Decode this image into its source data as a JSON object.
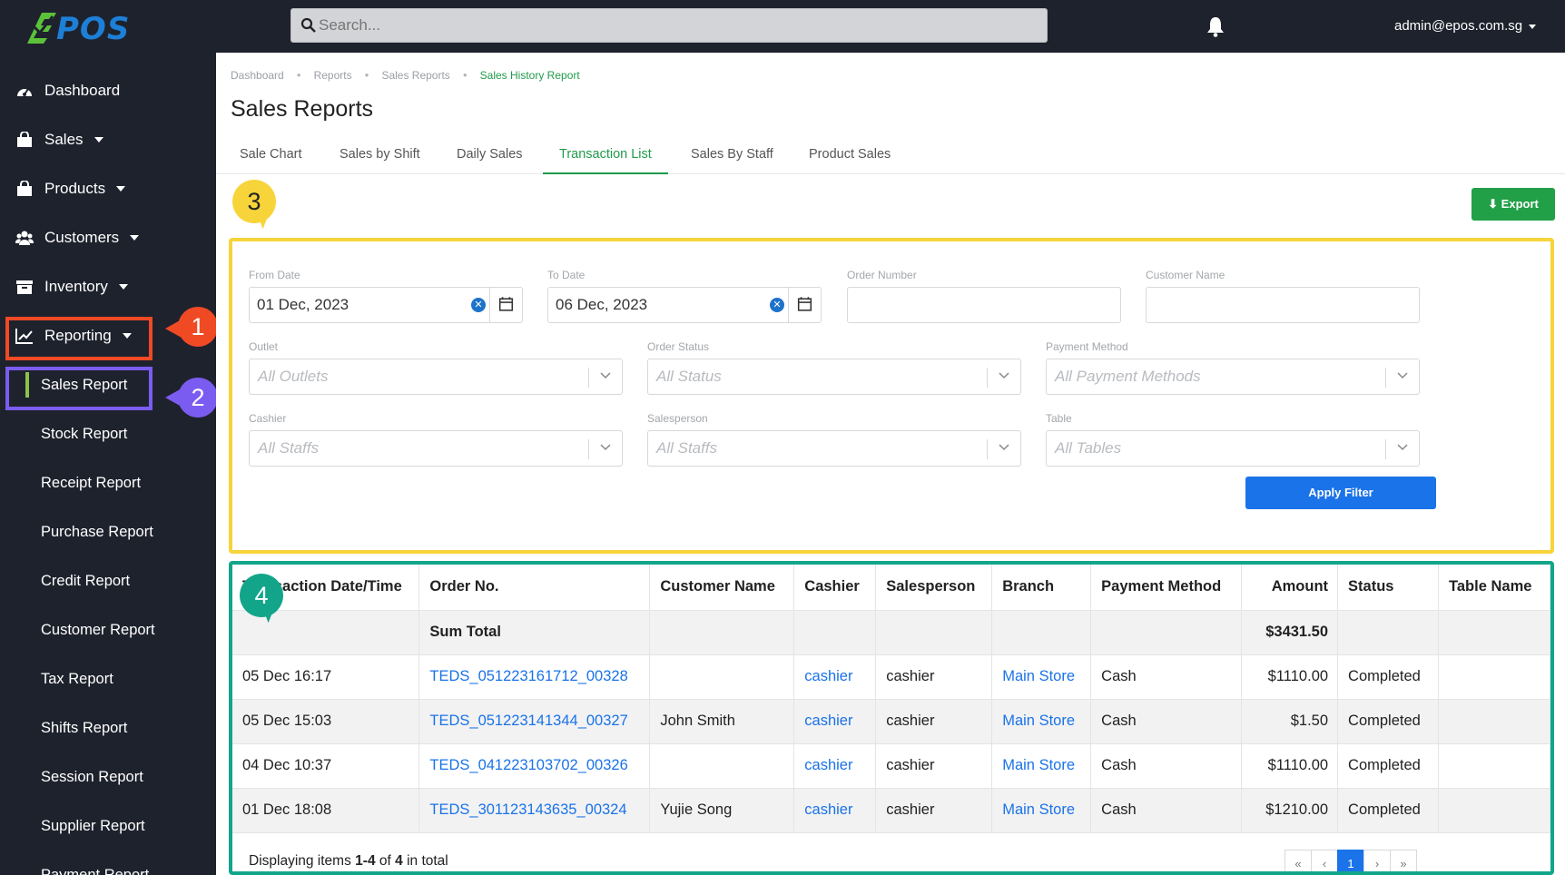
{
  "app": {
    "logo_text": "POS",
    "logo_full": "ePOS",
    "search_placeholder": "Search...",
    "user_email": "admin@epos.com.sg"
  },
  "sidebar": {
    "items": [
      {
        "label": "Dashboard",
        "icon": "dashboard-icon"
      },
      {
        "label": "Sales",
        "icon": "shopping-bag-icon"
      },
      {
        "label": "Products",
        "icon": "box-icon"
      },
      {
        "label": "Customers",
        "icon": "users-icon"
      },
      {
        "label": "Inventory",
        "icon": "archive-icon"
      },
      {
        "label": "Reporting",
        "icon": "line-chart-icon"
      }
    ],
    "subitems": [
      {
        "label": "Sales Report"
      },
      {
        "label": "Stock Report"
      },
      {
        "label": "Receipt Report"
      },
      {
        "label": "Purchase Report"
      },
      {
        "label": "Credit Report"
      },
      {
        "label": "Customer Report"
      },
      {
        "label": "Tax Report"
      },
      {
        "label": "Shifts Report"
      },
      {
        "label": "Session Report"
      },
      {
        "label": "Supplier Report"
      },
      {
        "label": "Payment Report"
      }
    ]
  },
  "annotations": {
    "b1": "1",
    "b2": "2",
    "b3": "3",
    "b4": "4"
  },
  "breadcrumb": [
    "Dashboard",
    "Reports",
    "Sales Reports",
    "Sales History Report"
  ],
  "page_title": "Sales Reports",
  "tabs": [
    "Sale Chart",
    "Sales by Shift",
    "Daily Sales",
    "Transaction List",
    "Sales By Staff",
    "Product Sales"
  ],
  "active_tab": "Transaction List",
  "export_label": "Export",
  "filters": {
    "from_date_label": "From Date",
    "from_date_value": "01 Dec, 2023",
    "to_date_label": "To Date",
    "to_date_value": "06 Dec, 2023",
    "order_number_label": "Order Number",
    "order_number_value": "",
    "customer_name_label": "Customer Name",
    "customer_name_value": "",
    "outlet_label": "Outlet",
    "outlet_placeholder": "All Outlets",
    "order_status_label": "Order Status",
    "order_status_placeholder": "All Status",
    "payment_method_label": "Payment Method",
    "payment_method_placeholder": "All Payment Methods",
    "cashier_label": "Cashier",
    "cashier_placeholder": "All Staffs",
    "salesperson_label": "Salesperson",
    "salesperson_placeholder": "All Staffs",
    "table_label": "Table",
    "table_placeholder": "All Tables",
    "apply_label": "Apply Filter"
  },
  "table": {
    "columns": [
      "Transaction Date/Time",
      "Order No.",
      "Customer Name",
      "Cashier",
      "Salesperson",
      "Branch",
      "Payment Method",
      "Amount",
      "Status",
      "Table Name"
    ],
    "sum_label": "Sum Total",
    "sum_amount": "$3431.50",
    "rows": [
      [
        "05 Dec 16:17",
        "TEDS_051223161712_00328",
        "",
        "cashier",
        "cashier",
        "Main Store",
        "Cash",
        "$1110.00",
        "Completed",
        ""
      ],
      [
        "05 Dec 15:03",
        "TEDS_051223141344_00327",
        "John Smith",
        "cashier",
        "cashier",
        "Main Store",
        "Cash",
        "$1.50",
        "Completed",
        ""
      ],
      [
        "04 Dec 10:37",
        "TEDS_041223103702_00326",
        "",
        "cashier",
        "cashier",
        "Main Store",
        "Cash",
        "$1110.00",
        "Completed",
        ""
      ],
      [
        "01 Dec 18:08",
        "TEDS_301123143635_00324",
        "Yujie Song",
        "cashier",
        "cashier",
        "Main Store",
        "Cash",
        "$1210.00",
        "Completed",
        ""
      ]
    ],
    "displaying_prefix": "Displaying items",
    "displaying_range": "1-4",
    "displaying_of": "of",
    "displaying_total": "4",
    "displaying_suffix": "in total",
    "pager": [
      "«",
      "‹",
      "1",
      "›",
      "»"
    ]
  }
}
